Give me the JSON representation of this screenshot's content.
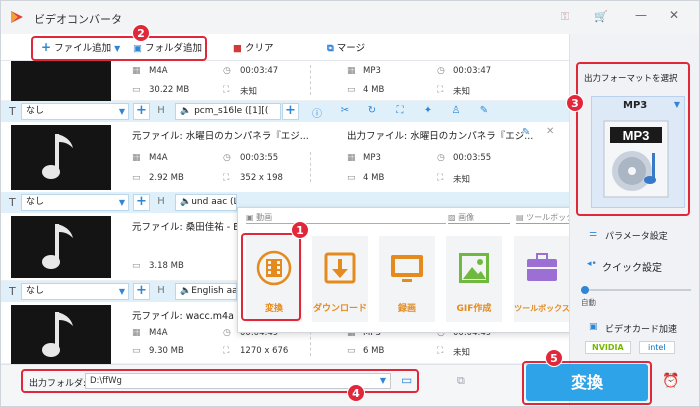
{
  "app": {
    "title": "ビデオコンバータ"
  },
  "toolbar": {
    "add_file": "ファイル追加",
    "add_folder": "フォルダ追加",
    "clear": "クリア",
    "merge": "マージ"
  },
  "rows": [
    {
      "src_format": "M4A",
      "src_duration": "00:03:47",
      "src_size": "30.22 MB",
      "src_res": "未知",
      "dst_format": "MP3",
      "dst_duration": "00:03:47",
      "dst_size": "4 MB",
      "dst_res": "未知"
    },
    {
      "src_name": "元ファイル: 水曜日のカンパネラ『エジ...",
      "dst_name": "出力ファイル: 水曜日のカンパネラ『エジ...",
      "src_format": "M4A",
      "src_duration": "00:03:55",
      "src_size": "2.92 MB",
      "src_res": "352 x 198",
      "dst_format": "MP3",
      "dst_duration": "00:03:55",
      "dst_size": "4 MB",
      "dst_res": "未知"
    },
    {
      "src_name": "元ファイル: 桑田佳祐 - E",
      "src_size": "3.18 MB"
    },
    {
      "src_name": "元ファイル: wacc.m4a",
      "src_format": "M4A",
      "src_duration": "00:04:49",
      "src_size": "9.30 MB",
      "src_res": "1270 x 676",
      "dst_format": "MP3",
      "dst_duration": "00:04:49",
      "dst_size": "6 MB",
      "dst_res": "未知"
    }
  ],
  "bars": [
    {
      "subtitle": "なし",
      "audio": "pcm_s16le ([1][("
    },
    {
      "subtitle": "なし",
      "audio": "und aac (LC) (mp"
    },
    {
      "subtitle": "なし",
      "audio": "English aac"
    }
  ],
  "popup": {
    "sec_video": "動画",
    "sec_image": "画像",
    "sec_toolbox": "ツールボックス",
    "tiles": [
      "変換",
      "ダウンロード",
      "録画",
      "GIF作成",
      "ツールボックス"
    ]
  },
  "right": {
    "select_format": "出力フォーマットを選択",
    "format": "MP3",
    "format_icon_text": "MP3",
    "params": "パラメータ設定",
    "quick": "クイック設定",
    "auto": "自動",
    "gpu": "ビデオカード加速",
    "nvidia": "NVIDIA",
    "intel": "intel"
  },
  "bottom": {
    "out_label": "出力フォルダ:",
    "out_path": "D:\\ffWg",
    "convert": "変換"
  },
  "badges": [
    "1",
    "2",
    "3",
    "4",
    "5"
  ],
  "colors": {
    "accent": "#2ea3e8",
    "highlight": "#e0283a",
    "tile_orange": "#e58a1c"
  }
}
